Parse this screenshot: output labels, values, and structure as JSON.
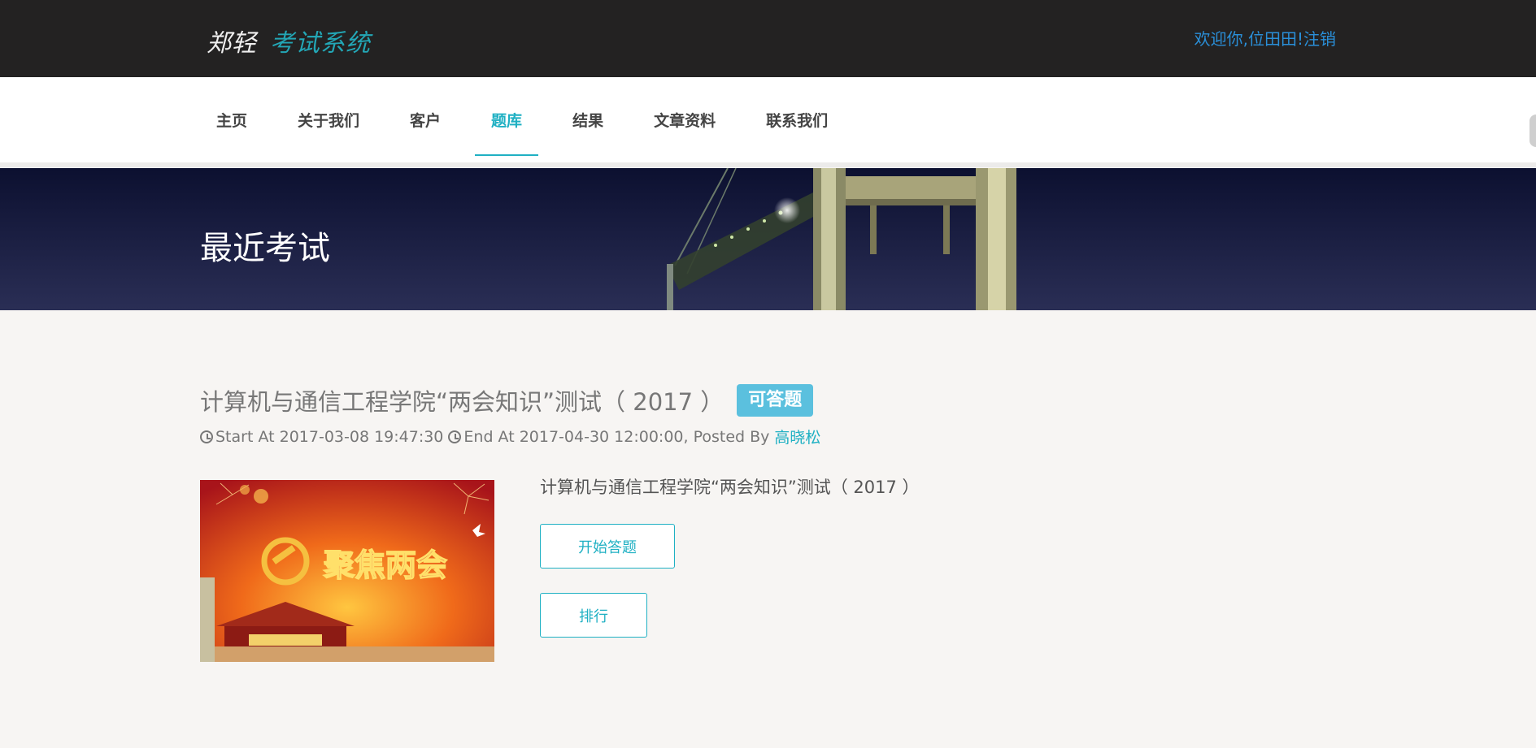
{
  "header": {
    "brand_part1": "郑轻",
    "brand_part2": "考试系统",
    "welcome": "欢迎你,位田田!",
    "logout": "注销"
  },
  "nav": {
    "items": [
      {
        "label": "主页"
      },
      {
        "label": "关于我们"
      },
      {
        "label": "客户"
      },
      {
        "label": "题库",
        "active": true
      },
      {
        "label": "结果"
      },
      {
        "label": "文章资料"
      },
      {
        "label": "联系我们"
      }
    ]
  },
  "banner": {
    "title": "最近考试"
  },
  "exam": {
    "title": "计算机与通信工程学院“两会知识”测试（ 2017 ）",
    "badge": "可答题",
    "start_label": "Start At 2017-03-08 19:47:30",
    "end_label": "End At 2017-04-30 12:00:00, Posted By",
    "author": "高晓松",
    "description": "计算机与通信工程学院“两会知识”测试（ 2017 ）",
    "image_text": "聚焦两会",
    "start_button": "开始答题",
    "rank_button": "排行"
  },
  "colors": {
    "accent": "#1fb0c3",
    "topbar": "#232222",
    "badge": "#5bc0de",
    "link": "#2a8fd8"
  }
}
